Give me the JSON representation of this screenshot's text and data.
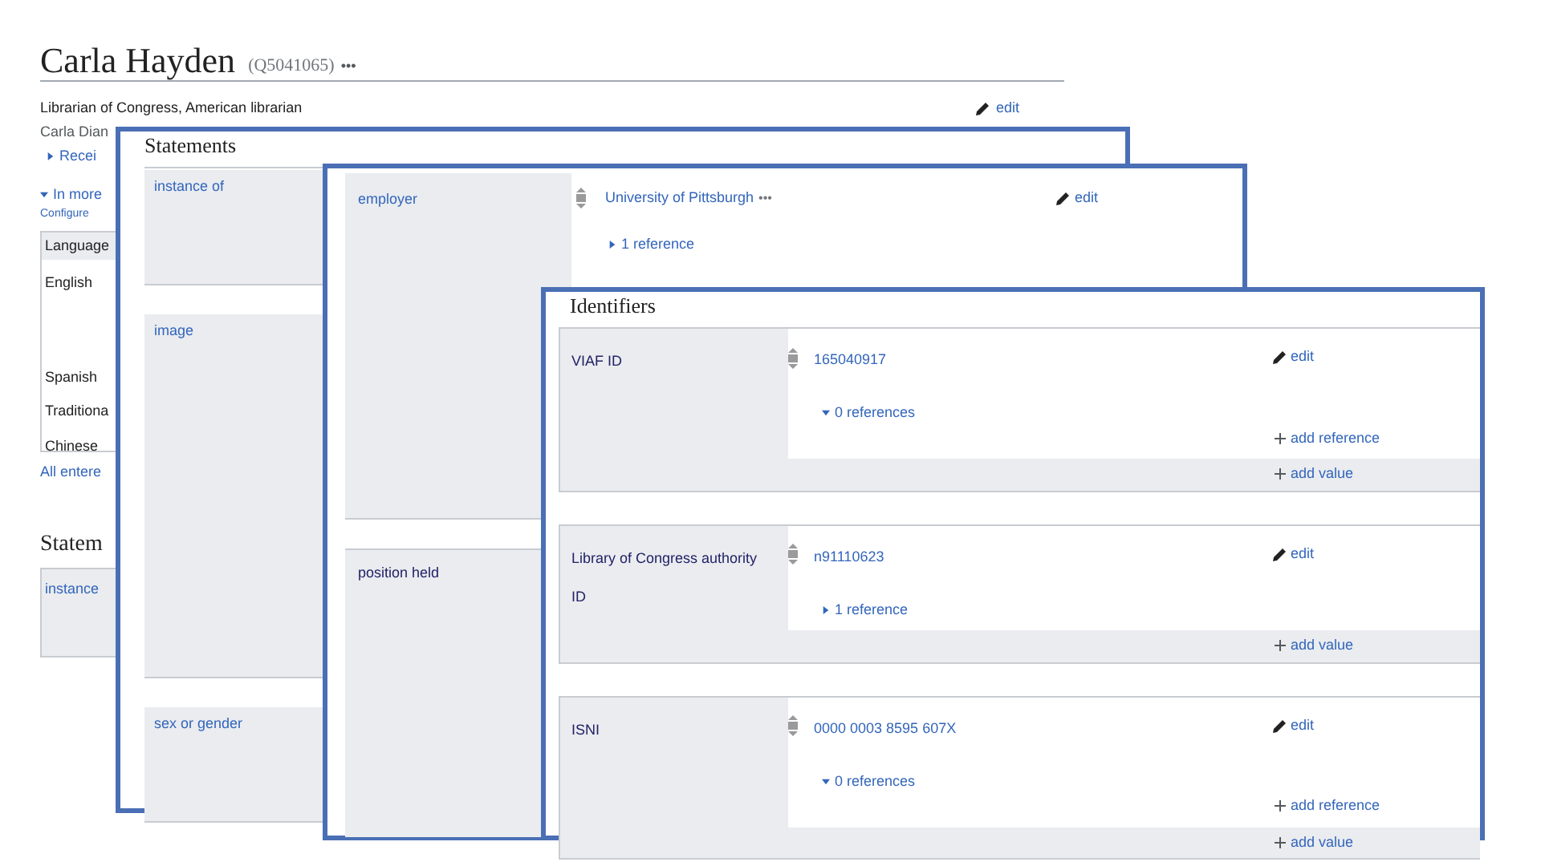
{
  "item": {
    "title": "Carla Hayden",
    "qid": "(Q5041065)",
    "more": "•••",
    "description": "Librarian of Congress, American librarian",
    "edit": "edit",
    "alias": "Carla Dian",
    "receive": {
      "label": "Recei",
      "expanded": false
    },
    "in_more": {
      "label": "In more",
      "expanded": true
    },
    "configure": "Configure",
    "languages_header": "Language",
    "languages": [
      {
        "name": "English"
      },
      {
        "name": "Spanish"
      },
      {
        "name": "Traditiona"
      },
      {
        "name": "Chinese"
      }
    ],
    "all_entered": "All entere",
    "statements_heading": "Statem",
    "first_property": "instance"
  },
  "statements": {
    "heading": "Statements",
    "properties": [
      {
        "label": "instance of"
      },
      {
        "label": "image"
      },
      {
        "label": "sex or gender"
      }
    ]
  },
  "employer": {
    "property": "employer",
    "value": "University of Pittsburgh",
    "more": "•••",
    "edit": "edit",
    "reference": {
      "label": "1 reference",
      "expanded": false
    },
    "next_property": "position held"
  },
  "identifiers": {
    "heading": "Identifiers",
    "rows": [
      {
        "label": "VIAF ID",
        "value": "165040917",
        "edit": "edit",
        "reference": {
          "label": "0 references",
          "expanded": true
        },
        "add_reference": "add reference",
        "add_value": "add value"
      },
      {
        "label": "Library of Congress authority ID",
        "value": "n91110623",
        "edit": "edit",
        "reference": {
          "label": "1 reference",
          "expanded": false
        },
        "add_value": "add value"
      },
      {
        "label": "ISNI",
        "value": "0000 0003 8595 607X",
        "edit": "edit",
        "reference": {
          "label": "0 references",
          "expanded": true
        },
        "add_reference": "add reference",
        "add_value": "add value"
      }
    ]
  }
}
